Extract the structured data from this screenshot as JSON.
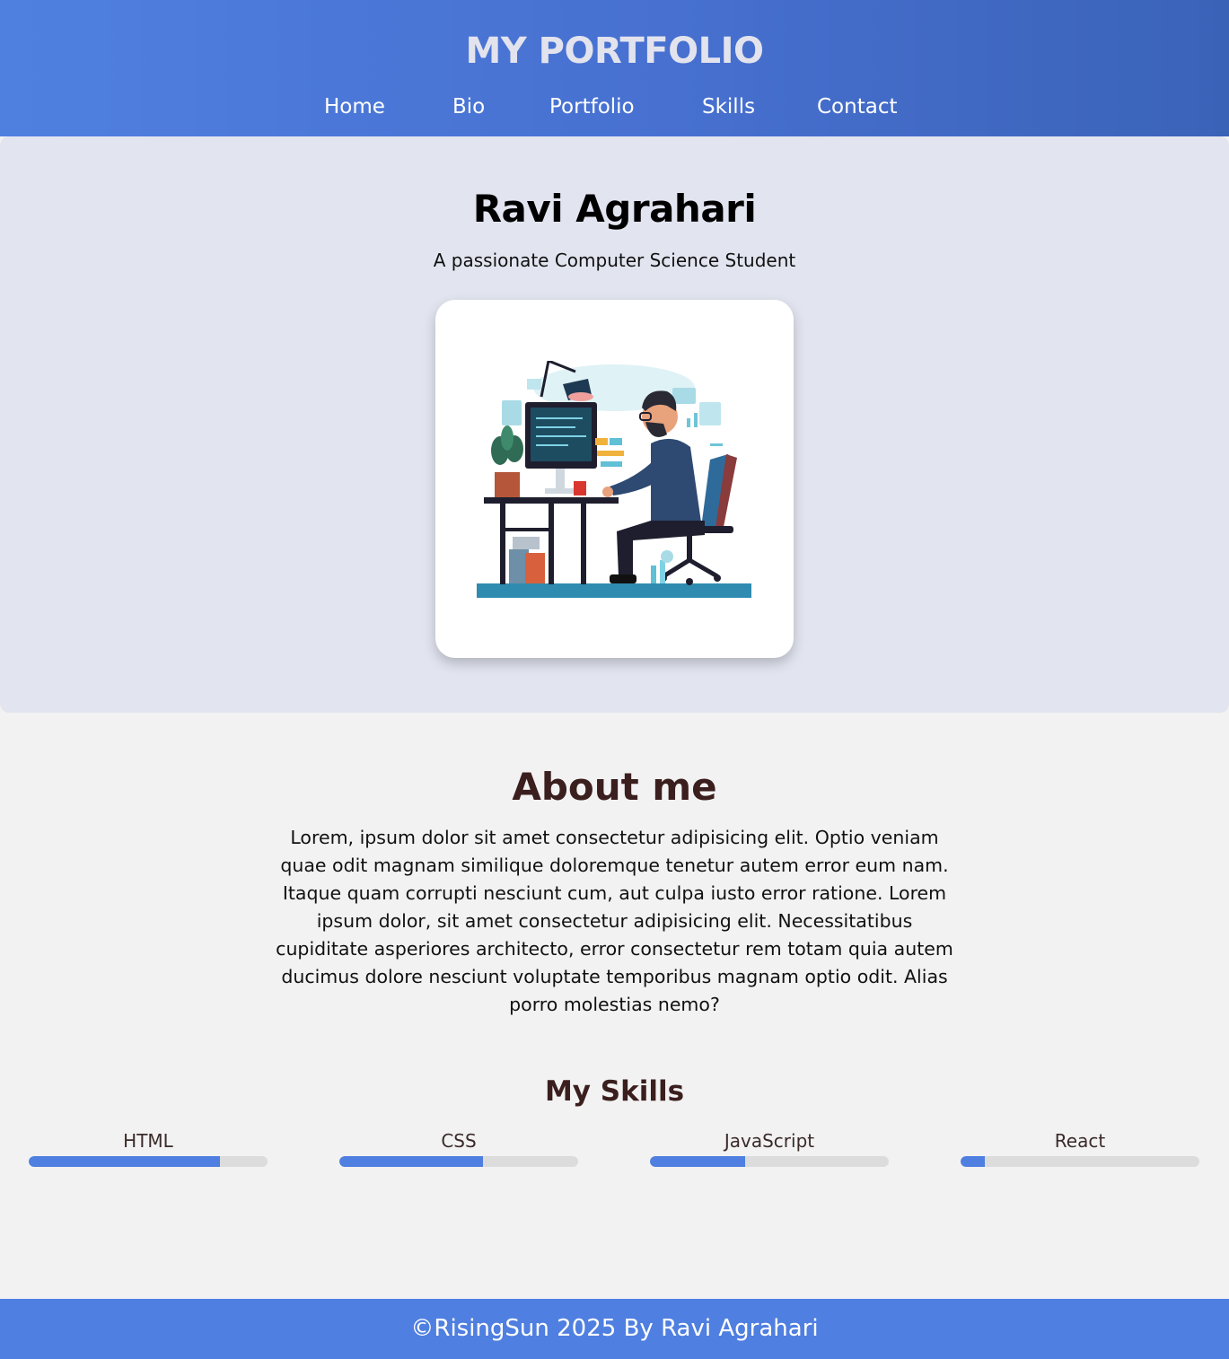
{
  "header": {
    "title": "MY PORTFOLIO",
    "nav": [
      "Home",
      "Bio",
      "Portfolio",
      "Skills",
      "Contact"
    ]
  },
  "hero": {
    "name": "Ravi Agrahari",
    "tagline": "A passionate Computer Science Student",
    "illustration": "developer-at-desk-illustration"
  },
  "about": {
    "title": "About me",
    "text": "Lorem, ipsum dolor sit amet consectetur adipisicing elit. Optio veniam quae odit magnam similique doloremque tenetur autem error eum nam. Itaque quam corrupti nesciunt cum, aut culpa iusto error ratione. Lorem ipsum dolor, sit amet consectetur adipisicing elit. Necessitatibus cupiditate asperiores architecto, error consectetur rem totam quia autem ducimus dolore nesciunt voluptate temporibus magnam optio odit. Alias porro molestias nemo?"
  },
  "skills": {
    "title": "My Skills",
    "items": [
      {
        "name": "HTML",
        "level": 0.8
      },
      {
        "name": "CSS",
        "level": 0.6
      },
      {
        "name": "JavaScript",
        "level": 0.4
      },
      {
        "name": "React",
        "level": 0.1
      }
    ]
  },
  "footer": {
    "text": "©RisingSun 2025 By Ravi Agrahari"
  },
  "colors": {
    "header_start": "#4f80e0",
    "header_end": "#3a63b8",
    "hero_bg": "#e2e5f0",
    "page_bg": "#f2f2f2",
    "skill_fill": "#4f7fe0",
    "heading_brown": "#3b1e1e"
  }
}
